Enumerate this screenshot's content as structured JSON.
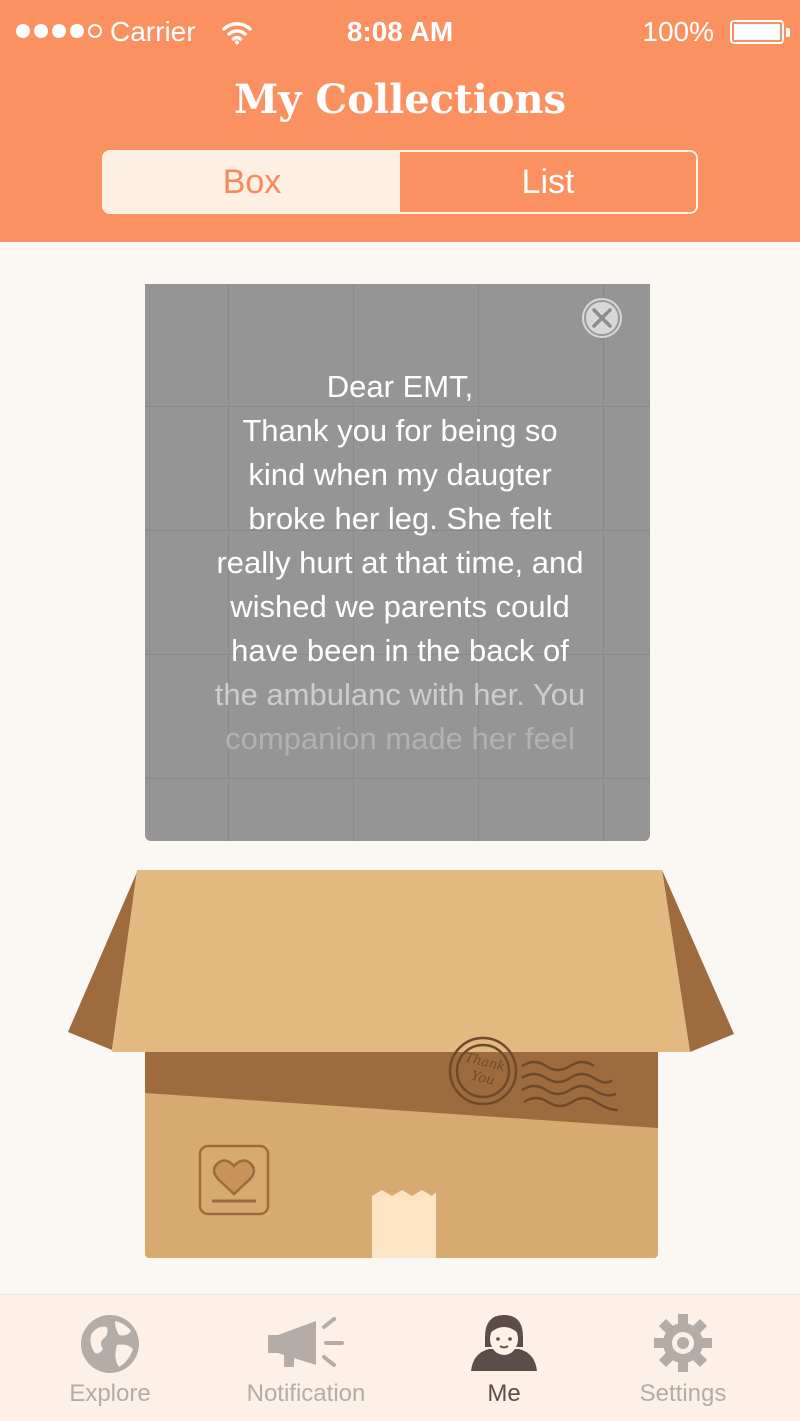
{
  "status_bar": {
    "carrier": "Carrier",
    "time": "8:08 AM",
    "battery": "100%"
  },
  "header": {
    "title": "My Collections",
    "segments": [
      {
        "label": "Box",
        "selected": true
      },
      {
        "label": "List",
        "selected": false
      }
    ]
  },
  "note": {
    "lines": [
      "Dear EMT,",
      "Thank you for being so",
      "kind when my daugter",
      "broke her leg. She felt",
      "really hurt at that time, and",
      "wished we parents could",
      "have been in the back of",
      "the ambulanc with her. You",
      "companion made her feel"
    ]
  },
  "box": {
    "stamp_lines": [
      "Thank",
      "You"
    ]
  },
  "tabbar": {
    "tabs": [
      {
        "label": "Explore",
        "icon": "globe-icon",
        "active": false
      },
      {
        "label": "Notification",
        "icon": "megaphone-icon",
        "active": false
      },
      {
        "label": "Me",
        "icon": "person-icon",
        "active": true
      },
      {
        "label": "Settings",
        "icon": "gear-icon",
        "active": false
      }
    ]
  },
  "colors": {
    "accent": "#fb9061",
    "segment_active_bg": "#fdf0e3",
    "note_bg": "#959595",
    "box_main": "#d7aa72",
    "box_flap": "#e3b982",
    "box_dark": "#9d6b3d",
    "tabbar_bg": "#fdf0e6"
  }
}
